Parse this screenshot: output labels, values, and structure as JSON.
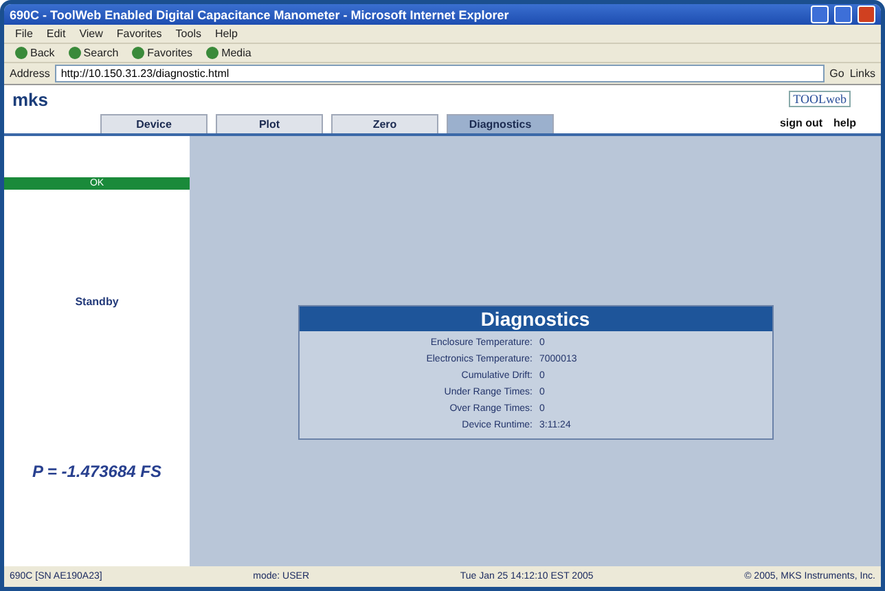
{
  "window": {
    "title": "690C - ToolWeb Enabled Digital Capacitance Manometer - Microsoft Internet Explorer"
  },
  "menu": [
    "File",
    "Edit",
    "View",
    "Favorites",
    "Tools",
    "Help"
  ],
  "toolbar": [
    "Back",
    "Search",
    "Favorites",
    "Media"
  ],
  "address": {
    "label": "Address",
    "value": "http://10.150.31.23/diagnostic.html",
    "go": "Go",
    "links": "Links"
  },
  "header": {
    "logo": "mks",
    "brand": "TOOLweb",
    "links": [
      "sign out",
      "help"
    ]
  },
  "tabs": [
    {
      "label": "Device",
      "selected": false
    },
    {
      "label": "Plot",
      "selected": false
    },
    {
      "label": "Zero",
      "selected": false
    },
    {
      "label": "Diagnostics",
      "selected": true
    }
  ],
  "sidebar": {
    "status": "OK",
    "state": "Standby",
    "reading": "P = -1.473684 FS"
  },
  "panel": {
    "title": "Diagnostics",
    "rows": [
      {
        "label": "Enclosure Temperature:",
        "value": "0"
      },
      {
        "label": "Electronics Temperature:",
        "value": "7000013"
      },
      {
        "label": "Cumulative Drift:",
        "value": "0"
      },
      {
        "label": "Under Range Times:",
        "value": "0"
      },
      {
        "label": "Over Range Times:",
        "value": "0"
      },
      {
        "label": "Device Runtime:",
        "value": "3:11:24"
      }
    ]
  },
  "status_bar": [
    "690C [SN AE190A23]",
    "mode: USER",
    "Tue Jan 25 14:12:10 EST 2005",
    "© 2005, MKS Instruments, Inc."
  ]
}
